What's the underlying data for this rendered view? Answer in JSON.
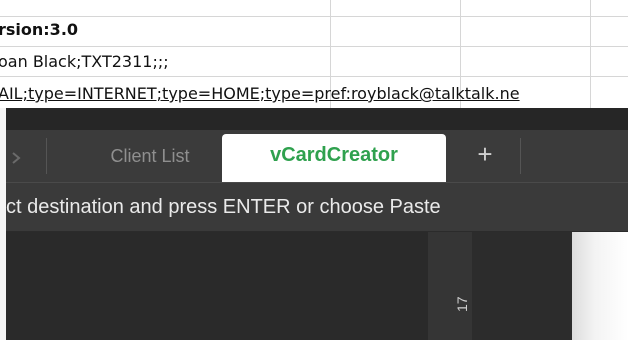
{
  "spreadsheet": {
    "rows": [
      {
        "text": "rsion:3.0",
        "bold": true
      },
      {
        "text": "oan Black;TXT2311;;;"
      },
      {
        "text": "AIL;type=INTERNET;type=HOME;type=pref:royblack@talktalk.ne"
      }
    ]
  },
  "tabs": [
    {
      "label": "Client List"
    },
    {
      "label": "vCardCreator"
    }
  ],
  "tab_add_label": "+",
  "instruction": "ct destination and press ENTER or choose Paste",
  "ruler": {
    "label": "17"
  },
  "icons": {
    "tab_overflow": "chevron-right-icon",
    "add_tab": "plus-icon"
  },
  "colors": {
    "active_tab_text": "#2fa14e"
  }
}
